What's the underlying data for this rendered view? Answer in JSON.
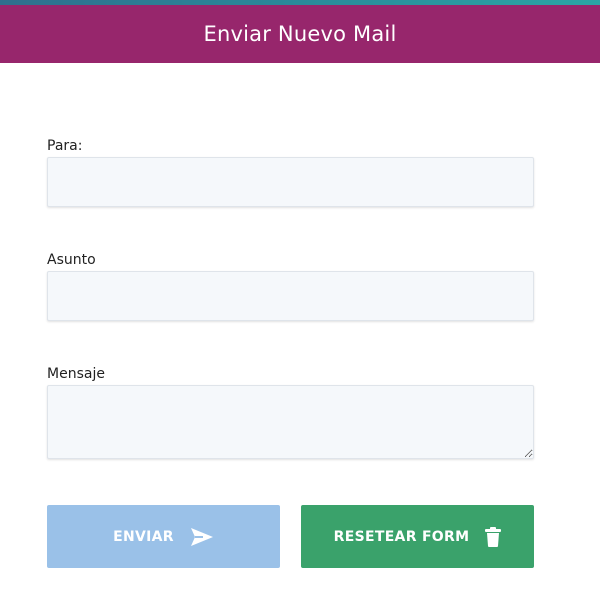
{
  "header": {
    "title": "Enviar Nuevo Mail"
  },
  "form": {
    "to": {
      "label": "Para:",
      "value": "",
      "placeholder": ""
    },
    "subject": {
      "label": "Asunto",
      "value": "",
      "placeholder": ""
    },
    "message": {
      "label": "Mensaje",
      "value": "",
      "placeholder": ""
    }
  },
  "buttons": {
    "send": {
      "label": "ENVIAR",
      "icon": "paper-plane-icon",
      "color": "#9ac1e8"
    },
    "reset": {
      "label": "RESETEAR FORM",
      "icon": "trash-icon",
      "color": "#3aa26b"
    }
  },
  "colors": {
    "header": "#97266c",
    "accent_bar": "#2a8a9a"
  }
}
